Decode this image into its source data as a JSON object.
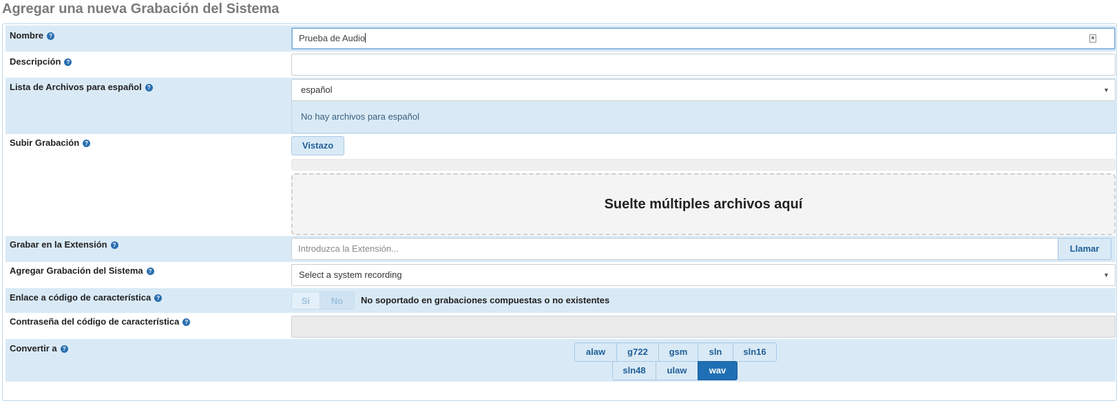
{
  "page": {
    "title": "Agregar una nueva Grabación del Sistema"
  },
  "help_glyph": "?",
  "fields": {
    "name": {
      "label": "Nombre",
      "value": "Prueba de Audio"
    },
    "description": {
      "label": "Descripción",
      "value": ""
    },
    "file_list": {
      "label": "Lista de Archivos para español",
      "selected": "español",
      "empty_text": "No hay archivos para español"
    },
    "upload": {
      "label": "Subir Grabación",
      "browse_label": "Vistazo",
      "dropzone_text": "Suelte múltiples archivos aquí"
    },
    "record_extension": {
      "label": "Grabar en la Extensión",
      "placeholder": "Introduzca la Extensión...",
      "call_label": "Llamar"
    },
    "add_system_recording": {
      "label": "Agregar Grabación del Sistema",
      "selected": "Select a system recording"
    },
    "feature_code_link": {
      "label": "Enlace a código de característica",
      "yes_label": "Si",
      "no_label": "No",
      "selected": "No",
      "note": "No soportado en grabaciones compuestas o no existentes"
    },
    "feature_code_password": {
      "label": "Contraseña del código de característica",
      "value": ""
    },
    "convert_to": {
      "label": "Convertir a",
      "formats_row1": [
        "alaw",
        "g722",
        "gsm",
        "sln",
        "sln16"
      ],
      "formats_row2": [
        "sln48",
        "ulaw",
        "wav"
      ],
      "selected": [
        "wav"
      ]
    }
  },
  "colors": {
    "row_shade": "#d9eaf6",
    "accent": "#1f6fb5",
    "title_gray": "#7a7a7a"
  }
}
